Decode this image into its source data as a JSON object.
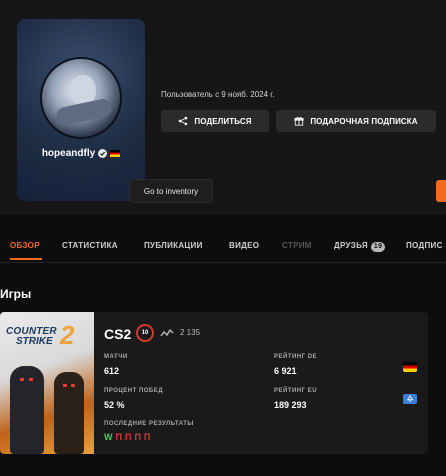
{
  "profile": {
    "username": "hopeandfly",
    "member_since": "Пользователь с 9 нояб. 2024 г.",
    "tooltip": "Go to inventory",
    "share_label": "ПОДЕЛИТЬСЯ",
    "gift_label": "ПОДАРОЧНАЯ ПОДПИСКА"
  },
  "tabs": [
    {
      "label": "ОБЗОР",
      "state": "active"
    },
    {
      "label": "СТАТИСТИКА",
      "state": "normal"
    },
    {
      "label": "ПУБЛИКАЦИИ",
      "state": "normal"
    },
    {
      "label": "ВИДЕО",
      "state": "normal"
    },
    {
      "label": "СТРИМ",
      "state": "disabled"
    },
    {
      "label": "ДРУЗЬЯ",
      "state": "normal",
      "badge": "19"
    },
    {
      "label": "ПОДПИС",
      "state": "normal"
    }
  ],
  "games_section": {
    "title": "Игры",
    "game": {
      "cover_text_1": "COUNTER",
      "cover_text_2": "STRIKE",
      "cover_text_3": "2",
      "name": "CS2",
      "level": "10",
      "elo": "2 135",
      "matches_label": "МАТЧИ",
      "matches_value": "612",
      "winrate_label": "ПРОЦЕНТ ПОБЕД",
      "winrate_value": "52 %",
      "rating_de_label": "РЕЙТИНГ DE",
      "rating_de_value": "6 921",
      "rating_eu_label": "РЕЙТИНГ EU",
      "rating_eu_value": "189 293",
      "results_label": "ПОСЛЕДНИЕ РЕЗУЛЬТАТЫ",
      "results": [
        "W",
        "П",
        "П",
        "П",
        "П"
      ]
    }
  },
  "colors": {
    "accent": "#f26b1d",
    "win": "#3fd14a",
    "loss": "#e0363b",
    "level_ring": "#d83a2a"
  },
  "icons": [
    "verified-icon",
    "flag-de-icon",
    "share-icon",
    "gift-icon",
    "elo-graph-icon",
    "eu-region-icon"
  ]
}
